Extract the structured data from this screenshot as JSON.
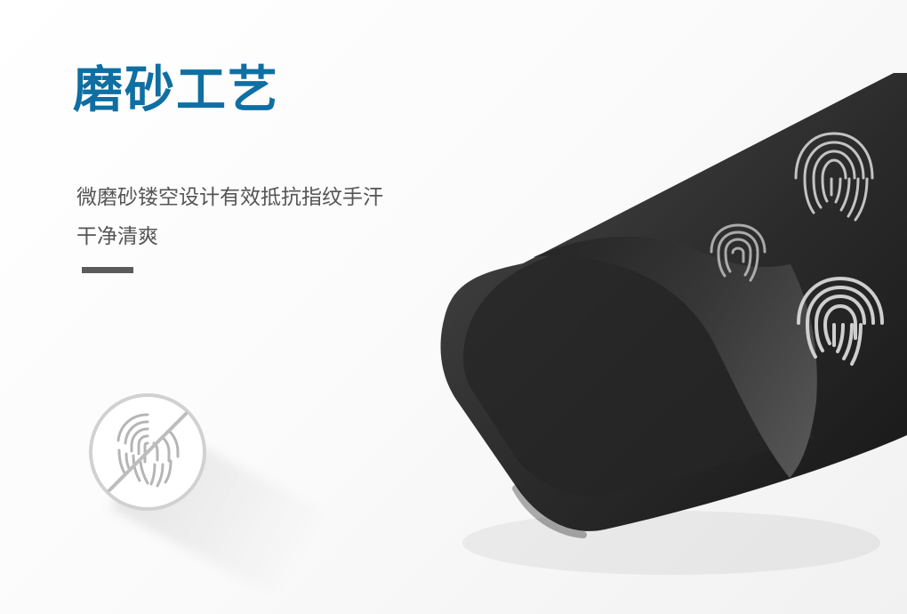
{
  "title": "磨砂工艺",
  "subtitle": {
    "line1": "微磨砂镂空设计有效抵抗指纹手汗",
    "line2": "干净清爽"
  },
  "colors": {
    "title_blue": "#0f6fa3",
    "text_gray": "#555555",
    "divider_gray": "#5b5b5b",
    "case_dark": "#2a2a2a",
    "case_mid": "#4a4a4a"
  },
  "icons": {
    "badge": "no-fingerprint-icon",
    "marks": "fingerprint-icon"
  }
}
